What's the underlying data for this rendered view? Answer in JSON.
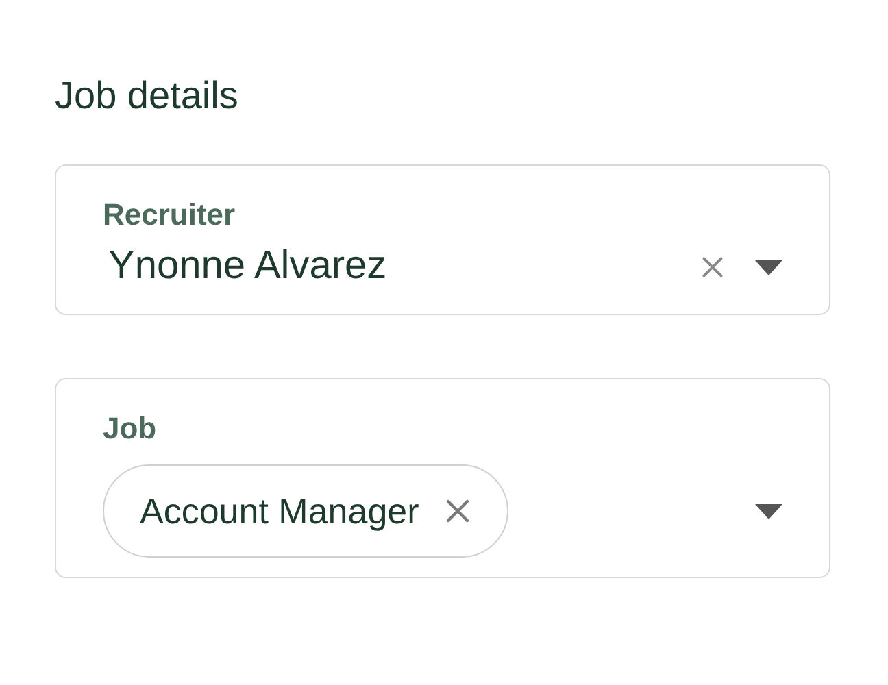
{
  "section_title": "Job details",
  "fields": [
    {
      "kind": "single",
      "label": "Recruiter",
      "value": "Ynonne Alvarez"
    },
    {
      "kind": "multi",
      "label": "Job",
      "chips": [
        "Account Manager"
      ]
    }
  ]
}
